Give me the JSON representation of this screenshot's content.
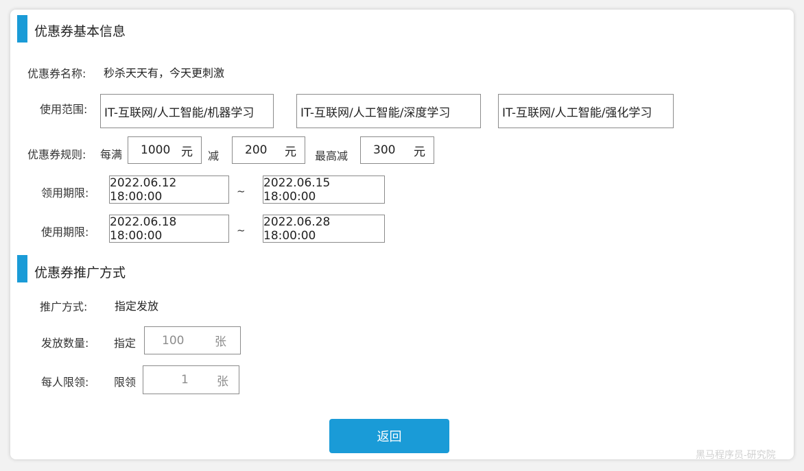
{
  "sections": {
    "basic_info_title": "优惠券基本信息",
    "promotion_title": "优惠券推广方式"
  },
  "coupon": {
    "name_label": "优惠券名称:",
    "name_value": "秒杀天天有，今天更刺激",
    "scope_label": "使用范围:",
    "scopes": [
      "IT-互联网/人工智能/机器学习",
      "IT-互联网/人工智能/深度学习",
      "IT-互联网/人工智能/强化学习"
    ],
    "rule_label": "优惠券规则:",
    "rule_every_full": "每满",
    "rule_threshold": "1000",
    "rule_unit1": "元",
    "rule_minus": "减",
    "rule_discount": "200",
    "rule_unit2": "元",
    "rule_max_minus": "最高减",
    "rule_max": "300",
    "rule_unit3": "元",
    "claim_period_label": "领用期限:",
    "claim_start": "2022.06.12 18:00:00",
    "claim_end": "2022.06.15 18:00:00",
    "use_period_label": "使用期限:",
    "use_start": "2022.06.18 18:00:00",
    "use_end": "2022.06.28 18:00:00",
    "tilde": "~"
  },
  "promotion": {
    "method_label": "推广方式:",
    "method_value": "指定发放",
    "quantity_label": "发放数量:",
    "quantity_prefix": "指定",
    "quantity_value": "100",
    "quantity_unit": "张",
    "limit_label": "每人限领:",
    "limit_prefix": "限领",
    "limit_value": "1",
    "limit_unit": "张"
  },
  "actions": {
    "back_label": "返回"
  },
  "watermark": "黑马程序员-研究院",
  "colors": {
    "accent": "#1a9bd7",
    "border": "#8a8a8a"
  }
}
